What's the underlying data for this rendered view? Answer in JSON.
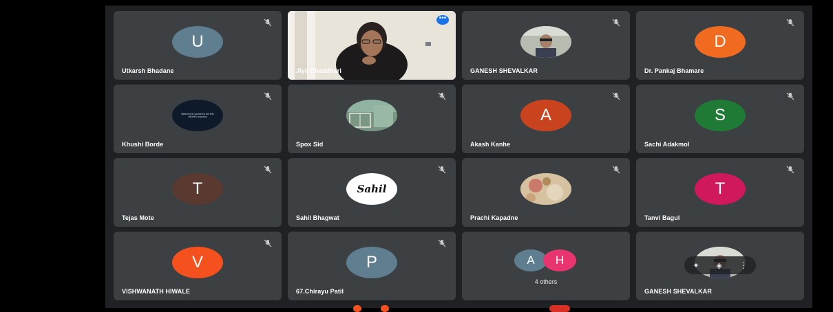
{
  "participants": [
    {
      "name": "Utkarsh Bhadane",
      "initial": "U",
      "color": "#5f7e8f"
    },
    {
      "name": "Jiya Chaudhari",
      "kind": "video"
    },
    {
      "name": "GANESH SHEVALKAR",
      "kind": "photo"
    },
    {
      "name": "Dr. Pankaj Bhamare",
      "initial": "D",
      "color": "#f06a1f"
    },
    {
      "name": "Khushi Borde",
      "kind": "photo",
      "caption": "Believing in yourself is the first secret to success"
    },
    {
      "name": "Spox Sid",
      "kind": "photo"
    },
    {
      "name": "Akash Kanhe",
      "initial": "A",
      "color": "#c9431f"
    },
    {
      "name": "Sachi Adakmol",
      "initial": "S",
      "color": "#1e7a35"
    },
    {
      "name": "Tejas Mote",
      "initial": "T",
      "color": "#5a3a30"
    },
    {
      "name": "Sahil Bhagwat",
      "kind": "photo",
      "logo_text": "Sahil"
    },
    {
      "name": "Prachi Kapadne",
      "kind": "photo"
    },
    {
      "name": "Tanvi Bagul",
      "initial": "T",
      "color": "#d0195c"
    },
    {
      "name": "VISHWANATH HIWALE",
      "initial": "V",
      "color": "#f4511e"
    },
    {
      "name": "67.Chirayu Patil",
      "initial": "P",
      "color": "#5f7e8f"
    },
    {
      "kind": "others",
      "label": "4 others",
      "avatars": [
        {
          "initial": "A",
          "color": "#5f7e8f"
        },
        {
          "initial": "H",
          "color": "#e8346f"
        }
      ]
    },
    {
      "name": "GANESH SHEVALKAR",
      "kind": "photo"
    }
  ],
  "icons": {
    "mute": "mic-off-icon",
    "more": "more-options-icon"
  },
  "colors": {
    "background": "#202124",
    "tile": "#3c4043",
    "accent": "#1a73e8"
  }
}
